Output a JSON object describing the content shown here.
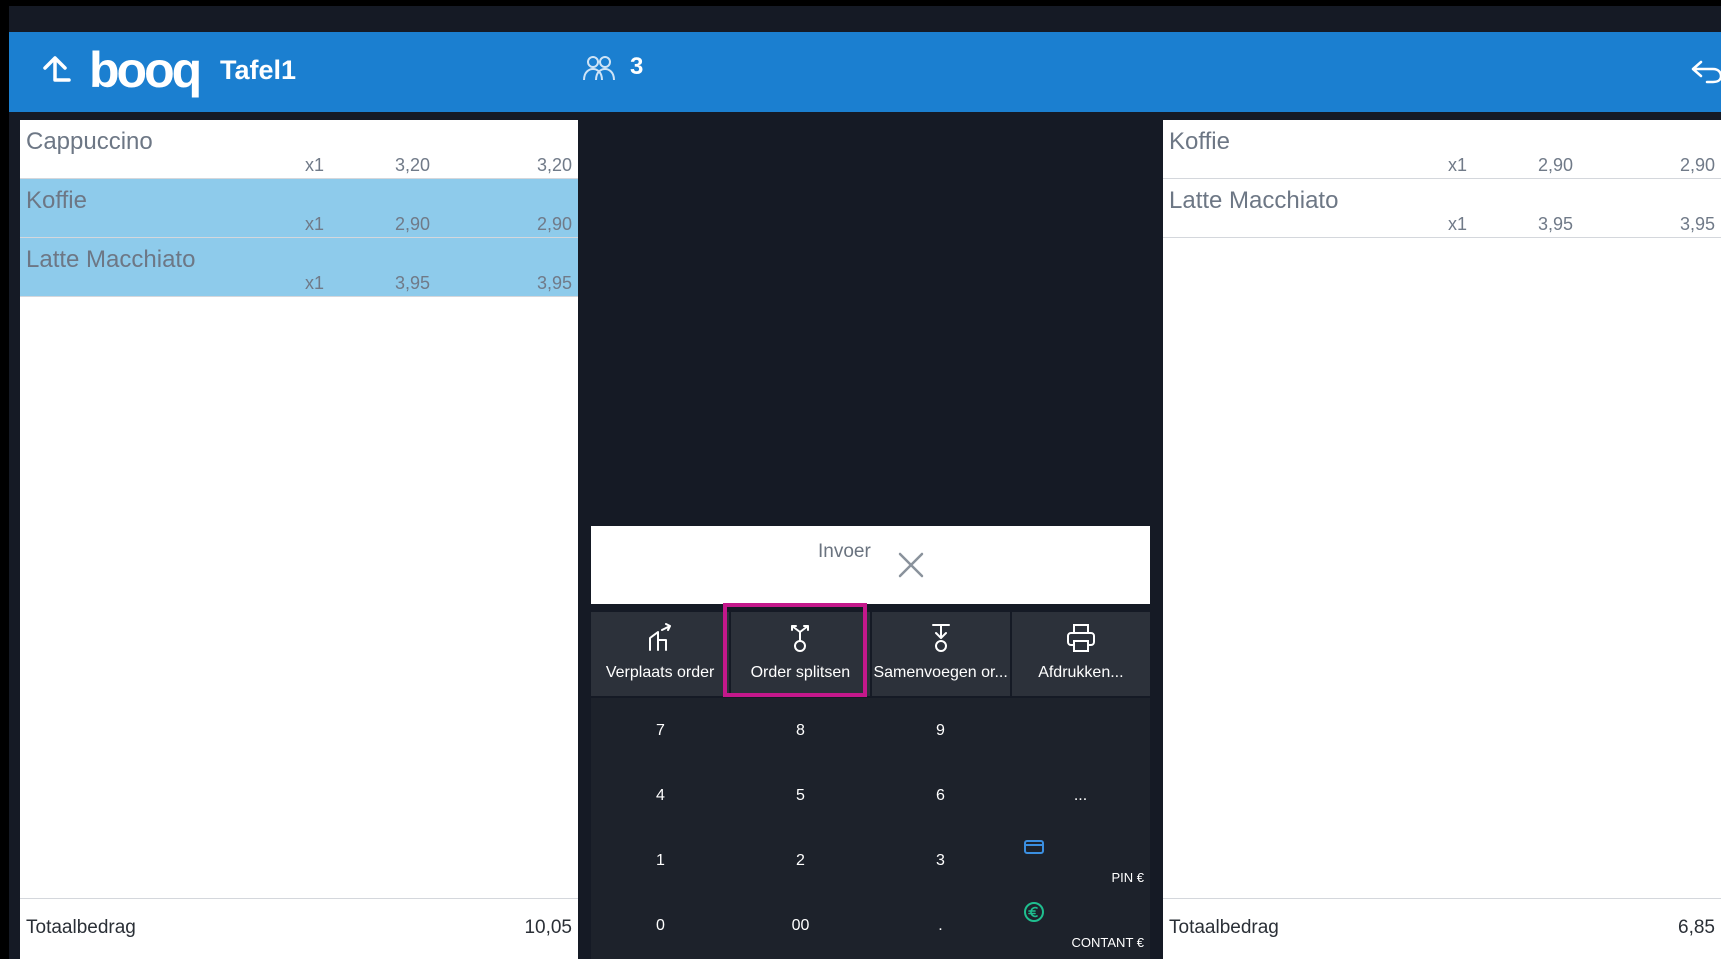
{
  "header": {
    "logo_text": "booq",
    "table_name": "Tafel1",
    "guest_count": "3"
  },
  "left_order": {
    "items": [
      {
        "name": "Cappuccino",
        "qty": "x1",
        "price": "3,20",
        "total": "3,20",
        "selected": false
      },
      {
        "name": "Koffie",
        "qty": "x1",
        "price": "2,90",
        "total": "2,90",
        "selected": true
      },
      {
        "name": "Latte Macchiato",
        "qty": "x1",
        "price": "3,95",
        "total": "3,95",
        "selected": true
      }
    ],
    "total_label": "Totaalbedrag",
    "total_amount": "10,05"
  },
  "right_order": {
    "items": [
      {
        "name": "Koffie",
        "qty": "x1",
        "price": "2,90",
        "total": "2,90"
      },
      {
        "name": "Latte Macchiato",
        "qty": "x1",
        "price": "3,95",
        "total": "3,95"
      }
    ],
    "total_label": "Totaalbedrag",
    "total_amount": "6,85"
  },
  "input": {
    "label": "Invoer"
  },
  "actions": [
    {
      "label": "Verplaats order",
      "icon": "move-order-icon"
    },
    {
      "label": "Order splitsen",
      "icon": "split-order-icon"
    },
    {
      "label": "Samenvoegen or...",
      "icon": "merge-order-icon"
    },
    {
      "label": "Afdrukken...",
      "icon": "printer-icon"
    }
  ],
  "keypad": {
    "keys": [
      "7",
      "8",
      "9",
      "4",
      "5",
      "6",
      "...",
      "1",
      "2",
      "3",
      "0",
      "00",
      "."
    ],
    "pin_label": "PIN €",
    "cash_label": "CONTANT €"
  },
  "colors": {
    "header_blue": "#1b7fd0",
    "selected_row": "#8ecbeb",
    "highlight": "#c4188b",
    "cash_icon": "#1fbf8f",
    "card_icon": "#3b8fe0"
  }
}
